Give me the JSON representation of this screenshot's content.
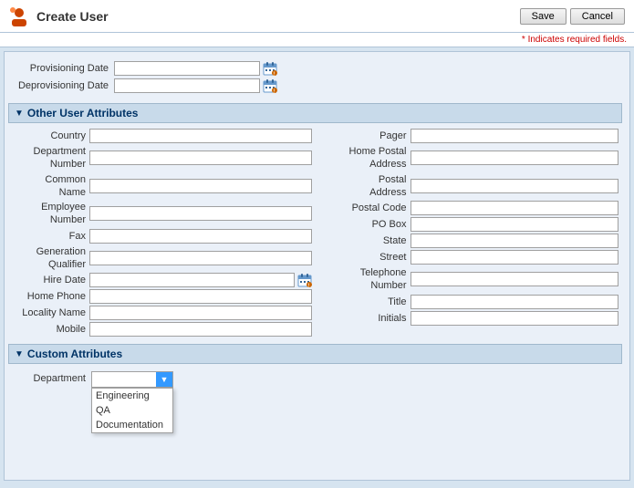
{
  "titleBar": {
    "title": "Create User",
    "saveLabel": "Save",
    "cancelLabel": "Cancel",
    "requiredNote": "* Indicates required fields."
  },
  "provisioningSection": {
    "provisioningDateLabel": "Provisioning Date",
    "deprovisioningDateLabel": "Deprovisioning Date"
  },
  "otherAttributes": {
    "sectionTitle": "Other User Attributes",
    "leftFields": [
      {
        "label": "Country",
        "name": "country"
      },
      {
        "label": "Department Number",
        "name": "department-number"
      },
      {
        "label": "Common Name",
        "name": "common-name"
      },
      {
        "label": "Employee Number",
        "name": "employee-number"
      },
      {
        "label": "Fax",
        "name": "fax"
      },
      {
        "label": "Generation Qualifier",
        "name": "generation-qualifier"
      },
      {
        "label": "Hire Date",
        "name": "hire-date",
        "hasCalendar": true
      },
      {
        "label": "Home Phone",
        "name": "home-phone"
      },
      {
        "label": "Locality Name",
        "name": "locality-name"
      },
      {
        "label": "Mobile",
        "name": "mobile"
      }
    ],
    "rightFields": [
      {
        "label": "Pager",
        "name": "pager"
      },
      {
        "label": "Home Postal Address",
        "name": "home-postal-address"
      },
      {
        "label": "Postal Address",
        "name": "postal-address"
      },
      {
        "label": "Postal Code",
        "name": "postal-code"
      },
      {
        "label": "PO Box",
        "name": "po-box"
      },
      {
        "label": "State",
        "name": "state"
      },
      {
        "label": "Street",
        "name": "street"
      },
      {
        "label": "Telephone Number",
        "name": "telephone-number"
      },
      {
        "label": "Title",
        "name": "title"
      },
      {
        "label": "Initials",
        "name": "initials"
      }
    ]
  },
  "customAttributes": {
    "sectionTitle": "Custom Attributes",
    "departmentLabel": "Department",
    "departmentOptions": [
      "Engineering",
      "QA",
      "Documentation"
    ],
    "selectedOption": ""
  },
  "icons": {
    "calendarIconLabel": "calendar-icon",
    "arrowDown": "▼",
    "sectionArrow": "▼",
    "userIconColor": "#cc4400"
  }
}
